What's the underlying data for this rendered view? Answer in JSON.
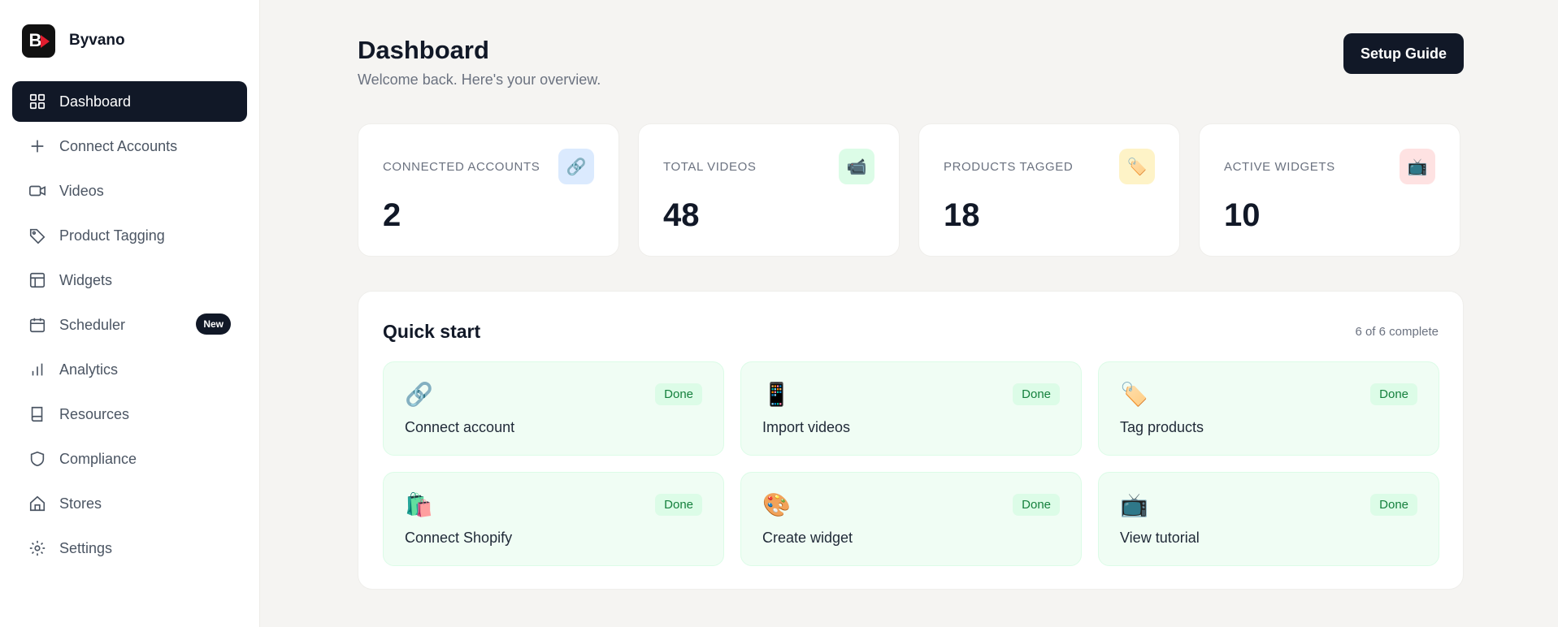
{
  "brand": {
    "name": "Byvano",
    "logo_letter": "B"
  },
  "sidebar": {
    "items": [
      {
        "label": "Dashboard",
        "icon": "grid-icon",
        "active": true
      },
      {
        "label": "Connect Accounts",
        "icon": "plus-icon"
      },
      {
        "label": "Videos",
        "icon": "video-icon"
      },
      {
        "label": "Product Tagging",
        "icon": "tag-icon"
      },
      {
        "label": "Widgets",
        "icon": "layout-icon"
      },
      {
        "label": "Scheduler",
        "icon": "calendar-icon",
        "badge": "New"
      },
      {
        "label": "Analytics",
        "icon": "bar-chart-icon"
      },
      {
        "label": "Resources",
        "icon": "book-icon"
      },
      {
        "label": "Compliance",
        "icon": "shield-icon"
      },
      {
        "label": "Stores",
        "icon": "home-icon"
      },
      {
        "label": "Settings",
        "icon": "gear-icon"
      }
    ]
  },
  "header": {
    "title": "Dashboard",
    "subtitle": "Welcome back. Here's your overview.",
    "setup_button": "Setup Guide"
  },
  "stats": [
    {
      "label": "CONNECTED ACCOUNTS",
      "value": "2",
      "icon": "link-icon",
      "icon_bg": "#dbeafe"
    },
    {
      "label": "TOTAL VIDEOS",
      "value": "48",
      "icon": "video-camera-icon",
      "icon_bg": "#dcfce7"
    },
    {
      "label": "PRODUCTS TAGGED",
      "value": "18",
      "icon": "tag-icon",
      "icon_bg": "#fef3c7"
    },
    {
      "label": "ACTIVE WIDGETS",
      "value": "10",
      "icon": "tv-icon",
      "icon_bg": "#fee2e2"
    }
  ],
  "quick_start": {
    "title": "Quick start",
    "progress": "6 of 6 complete",
    "tasks": [
      {
        "label": "Connect account",
        "status": "Done",
        "icon": "link-icon",
        "glyph": "🔗"
      },
      {
        "label": "Import videos",
        "status": "Done",
        "icon": "apps-icon",
        "glyph": "📱"
      },
      {
        "label": "Tag products",
        "status": "Done",
        "icon": "tag-icon",
        "glyph": "🏷️"
      },
      {
        "label": "Connect Shopify",
        "status": "Done",
        "icon": "shopping-bag-icon",
        "glyph": "🛍️"
      },
      {
        "label": "Create widget",
        "status": "Done",
        "icon": "palette-icon",
        "glyph": "🎨"
      },
      {
        "label": "View tutorial",
        "status": "Done",
        "icon": "tv-icon",
        "glyph": "📺"
      }
    ]
  },
  "colors": {
    "accent": "#111827",
    "sidebar_bg": "#ffffff",
    "page_bg": "#f5f4f2",
    "done_bg": "#f0fdf4",
    "done_text": "#15803d"
  }
}
